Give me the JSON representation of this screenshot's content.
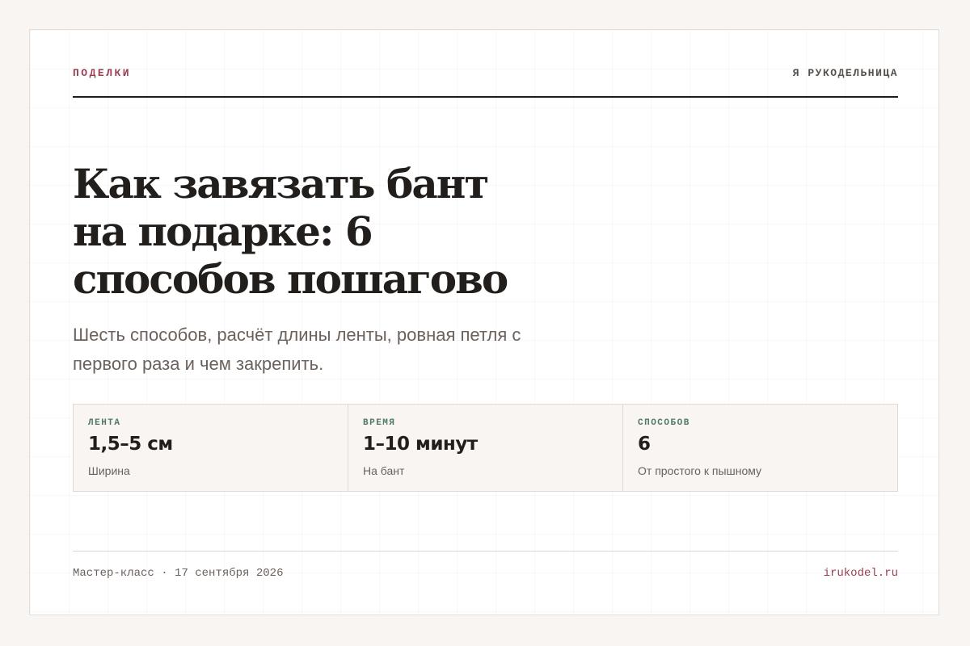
{
  "header": {
    "category": "ПОДЕЛКИ",
    "brand": "Я РУКОДЕЛЬНИЦА"
  },
  "article": {
    "title_lines": [
      "Как завязать бант",
      "на подарке: 6",
      "способов пошагово"
    ],
    "subtitle_lines": [
      "Шесть способов, расчёт длины ленты, ровная петля с",
      "первого раза и чем закрепить."
    ]
  },
  "stats": [
    {
      "label": "ЛЕНТА",
      "value": "1,5–5 см",
      "note": "Ширина"
    },
    {
      "label": "ВРЕМЯ",
      "value": "1–10 минут",
      "note": "На бант"
    },
    {
      "label": "СПОСОБОВ",
      "value": "6",
      "note": "От простого к пышному"
    }
  ],
  "footer": {
    "type": "Мастер-класс",
    "separator": "·",
    "date": "17 сентября 2026",
    "site": "irukodel.ru"
  },
  "colors": {
    "accent": "#9a3f52",
    "stat_label": "#4d7a61",
    "text": "#221e1c",
    "muted": "#6b625d"
  }
}
